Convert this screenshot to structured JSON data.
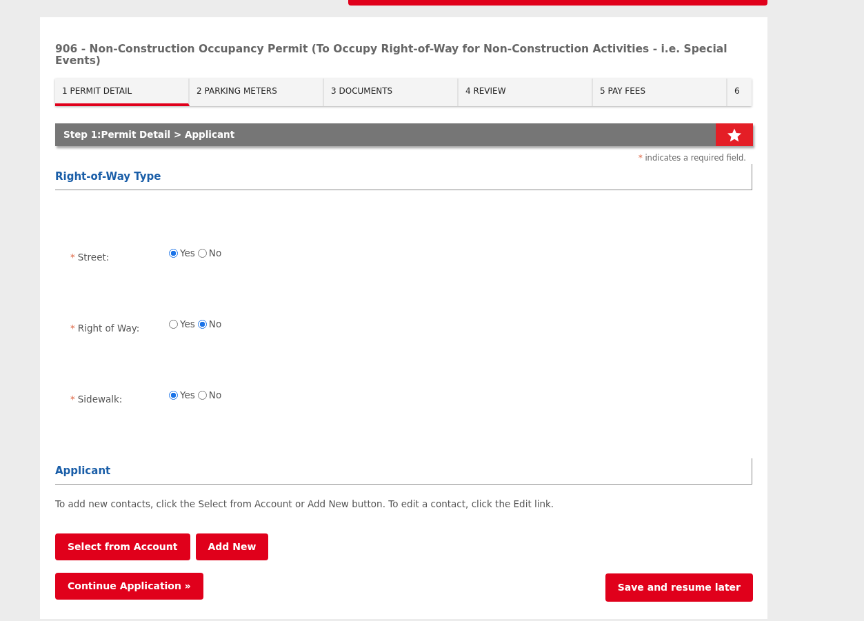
{
  "title": "906 - Non-Construction Occupancy Permit (To Occupy Right-of-Way for Non-Construction Activities - i.e. Special Events)",
  "tabs": [
    {
      "label": "1 PERMIT DETAIL",
      "selected": true
    },
    {
      "label": "2 PARKING METERS",
      "selected": false
    },
    {
      "label": "3 DOCUMENTS",
      "selected": false
    },
    {
      "label": "4 REVIEW",
      "selected": false
    },
    {
      "label": "5 PAY FEES",
      "selected": false
    },
    {
      "label": "6",
      "selected": false
    }
  ],
  "step_bar": {
    "step": "Step 1:",
    "page": "Permit Detail",
    "separator": ">",
    "section": "Applicant"
  },
  "required_note": {
    "mark": "*",
    "text": "indicates a required field."
  },
  "sections": [
    {
      "heading": "Right-of-Way Type",
      "fields": [
        {
          "label": "Street:",
          "required": true,
          "options": [
            {
              "label": "Yes",
              "selected": true
            },
            {
              "label": "No",
              "selected": false
            }
          ]
        },
        {
          "label": "Right of Way:",
          "required": true,
          "options": [
            {
              "label": "Yes",
              "selected": false
            },
            {
              "label": "No",
              "selected": true
            }
          ]
        },
        {
          "label": "Sidewalk:",
          "required": true,
          "options": [
            {
              "label": "Yes",
              "selected": true
            },
            {
              "label": "No",
              "selected": false
            }
          ]
        }
      ]
    },
    {
      "heading": "Applicant",
      "instructions": "To add new contacts, click the Select from Account or Add New button. To edit a contact, click the Edit link.",
      "buttons": [
        "Select from Account",
        "Add New"
      ]
    }
  ],
  "footer_buttons": {
    "continue": "Continue Application »",
    "save": "Save and resume later"
  }
}
